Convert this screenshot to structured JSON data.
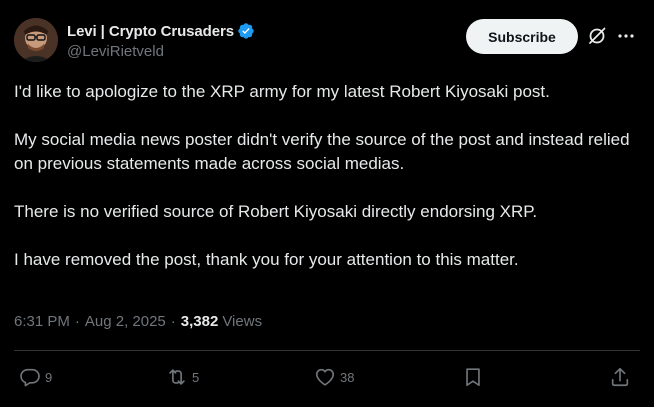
{
  "author": {
    "display_name": "Levi | Crypto Crusaders",
    "handle": "@LeviRietveld",
    "verified": true,
    "avatar": "avatar-photo"
  },
  "header": {
    "subscribe_label": "Subscribe",
    "icons": [
      "grok-icon",
      "more-icon"
    ]
  },
  "post": {
    "paragraphs": [
      "I'd like to apologize to the XRP army for my latest Robert Kiyosaki post.",
      "My social media news poster didn't verify the source of the post and instead relied on previous statements made across social medias.",
      "There is no verified source of Robert Kiyosaki directly endorsing XRP.",
      "I have removed the post, thank you for your attention to this matter."
    ]
  },
  "meta": {
    "time": "6:31 PM",
    "separator1": "·",
    "date": "Aug 2, 2025",
    "separator2": "·",
    "views_count": "3,382",
    "views_label": "Views"
  },
  "actions": {
    "replies": "9",
    "reposts": "5",
    "likes": "38"
  },
  "colors": {
    "background": "#000000",
    "text": "#e7e9ea",
    "secondary_text": "#71767b",
    "verified_badge": "#1d9bf0",
    "subscribe_bg": "#eff3f4",
    "divider": "#2f3336"
  }
}
